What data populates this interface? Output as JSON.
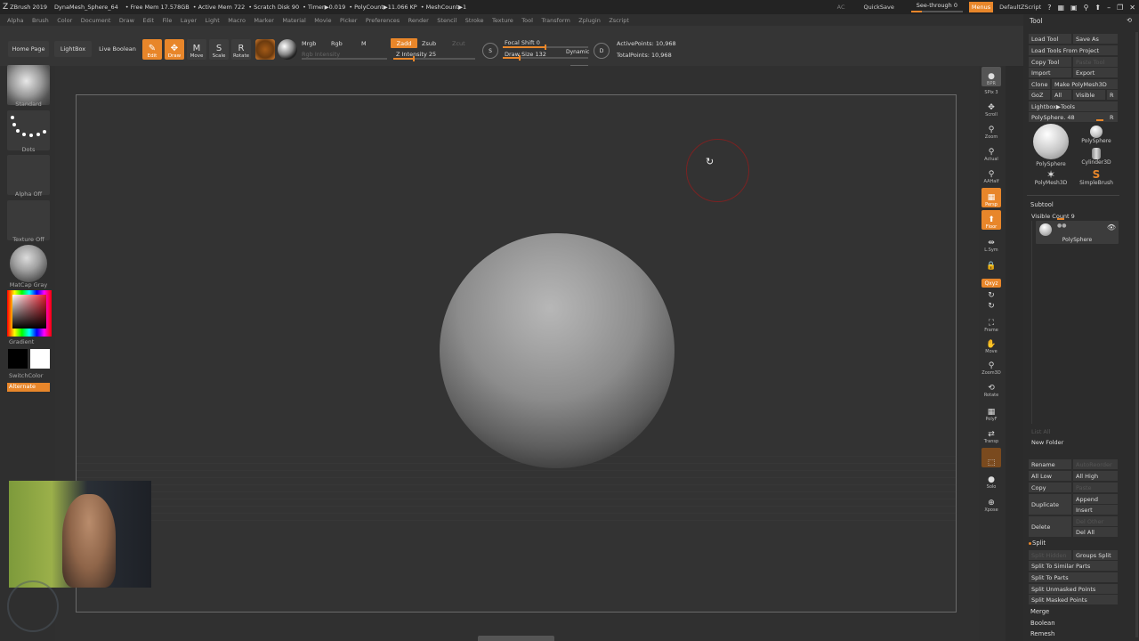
{
  "titlebar": {
    "logo": "Z",
    "app": "ZBrush 2019",
    "file": "DynaMesh_Sphere_64",
    "free_mem": "• Free Mem 17.578GB",
    "active_mem": "• Active Mem 722",
    "scratch": "• Scratch Disk 90",
    "timer": "• Timer▶0.019",
    "polycount": "• PolyCount▶11.066 KP",
    "meshcount": "• MeshCount▶1",
    "ac": "AC",
    "quicksave": "QuickSave",
    "see_through": "See-through  0",
    "menus": "Menus",
    "script": "DefaultZScript",
    "icons": [
      "?",
      "▦",
      "▣",
      "⚲",
      "⬆",
      "–",
      "❐",
      "✕"
    ]
  },
  "menubar": [
    "Alpha",
    "Brush",
    "Color",
    "Document",
    "Draw",
    "Edit",
    "File",
    "Layer",
    "Light",
    "Macro",
    "Marker",
    "Material",
    "Movie",
    "Picker",
    "Preferences",
    "Render",
    "Stencil",
    "Stroke",
    "Texture",
    "Tool",
    "Transform",
    "Zplugin",
    "Zscript"
  ],
  "toolstrip": {
    "home": "Home Page",
    "lightbox": "LightBox",
    "live_boolean": "Live Boolean",
    "modes": [
      {
        "label": "Edit",
        "glyph": "✎",
        "active": true
      },
      {
        "label": "Draw",
        "glyph": "✥",
        "active": true
      },
      {
        "label": "Move",
        "glyph": "M",
        "active": false
      },
      {
        "label": "Scale",
        "glyph": "S",
        "active": false
      },
      {
        "label": "Rotate",
        "glyph": "R",
        "active": false
      }
    ],
    "mrgb": "Mrgb",
    "rgb": "Rgb",
    "m": "M",
    "rgb_intensity": "Rgb Intensity",
    "zadd": "Zadd",
    "zsub": "Zsub",
    "zcut": "Zcut",
    "z_intensity": "Z Intensity 25",
    "focal_shift": "Focal Shift 0",
    "draw_size": "Draw Size 132",
    "dynamic": "Dynamic",
    "active_points": "ActivePoints: 10,968",
    "total_points": "TotalPoints: 10,968",
    "s_icon": "S",
    "d_icon": "D",
    "z_intensity_level": 0.25,
    "focal_shift_level": 0.5,
    "draw_size_level": 0.2
  },
  "leftshelf": {
    "brush": "Standard",
    "stroke": "Dots",
    "alpha": "Alpha Off",
    "texture": "Texture Off",
    "material": "MatCap Gray",
    "gradient": "Gradient",
    "switchcolor": "SwitchColor",
    "alternate": "Alternate"
  },
  "rightshelf": [
    {
      "label": "BPR",
      "glyph": "●"
    },
    {
      "label": "SPix 3",
      "glyph": ""
    },
    {
      "label": "Scroll",
      "glyph": "✥"
    },
    {
      "label": "Zoom",
      "glyph": "⚲"
    },
    {
      "label": "Actual",
      "glyph": "⚲"
    },
    {
      "label": "AAHalf",
      "glyph": "⚲"
    },
    {
      "label": "Persp",
      "glyph": "▦"
    },
    {
      "label": "Floor",
      "glyph": "⬆"
    },
    {
      "label": "L.Sym",
      "glyph": "⇹"
    },
    {
      "label": "",
      "glyph": "🔒"
    },
    {
      "label": "Qxyz",
      "glyph": ""
    },
    {
      "label": "",
      "glyph": "↻"
    },
    {
      "label": "",
      "glyph": "↻"
    },
    {
      "label": "Frame",
      "glyph": "⛶"
    },
    {
      "label": "Move",
      "glyph": "✋"
    },
    {
      "label": "Zoom3D",
      "glyph": "⚲"
    },
    {
      "label": "Rotate",
      "glyph": "⟲"
    },
    {
      "label": "PolyF",
      "glyph": "▦"
    },
    {
      "label": "Transp",
      "glyph": "⇄"
    },
    {
      "label": "",
      "glyph": "⬚"
    },
    {
      "label": "Solo",
      "glyph": "●"
    },
    {
      "label": "Xpose",
      "glyph": "⊕"
    }
  ],
  "tool": {
    "title": "Tool",
    "buttons": {
      "load_tool": "Load Tool",
      "save_as": "Save As",
      "load_from_project": "Load Tools From Project",
      "copy_tool": "Copy Tool",
      "paste_tool": "Paste Tool",
      "import": "Import",
      "export": "Export",
      "clone": "Clone",
      "make_polymesh": "Make PolyMesh3D",
      "goz": "GoZ",
      "all": "All",
      "visible": "Visible",
      "r": "R",
      "lightbox_tools": "Lightbox▶Tools",
      "polysphere_slider": "PolySphere. 48",
      "r2": "R"
    },
    "thumbs": [
      "PolySphere",
      "PolySphere",
      "Cylinder3D",
      "PolyMesh3D",
      "SimpleBrush"
    ]
  },
  "subtool": {
    "title": "Subtool",
    "visible_count": "Visible Count 9",
    "item": "PolySphere",
    "list_all": "List All",
    "new_folder": "New Folder",
    "rename": "Rename",
    "autoreorder": "AutoReorder",
    "all_low": "All Low",
    "all_high": "All High",
    "copy": "Copy",
    "paste": "Paste",
    "duplicate": "Duplicate",
    "append": "Append",
    "insert": "Insert",
    "delete": "Delete",
    "del_other": "Del Other",
    "del_all": "Del All",
    "split": "Split",
    "split_hidden": "Split Hidden",
    "groups_split": "Groups Split",
    "split_similar": "Split To Similar Parts",
    "split_parts": "Split To Parts",
    "split_unmasked": "Split Unmasked Points",
    "split_masked": "Split Masked Points",
    "merge": "Merge",
    "boolean": "Boolean",
    "remesh": "Remesh"
  },
  "colors": {
    "accent": "#e8862a",
    "background": "#2b2b2b"
  }
}
